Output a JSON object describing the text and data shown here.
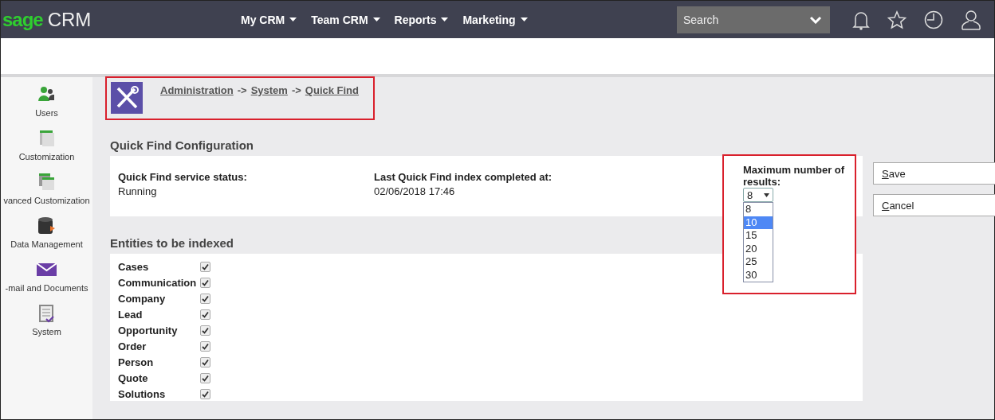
{
  "header": {
    "logo_brand": "sage",
    "logo_product": "CRM",
    "menus": [
      {
        "label": "My CRM"
      },
      {
        "label": "Team CRM"
      },
      {
        "label": "Reports"
      },
      {
        "label": "Marketing"
      }
    ],
    "search": {
      "placeholder": "Search"
    }
  },
  "sidebar": {
    "items": [
      {
        "label": "Users",
        "kind": "users"
      },
      {
        "label": "Customization",
        "kind": "custom"
      },
      {
        "label": "vanced Customization",
        "kind": "advanced"
      },
      {
        "label": "Data Management",
        "kind": "data"
      },
      {
        "label": "-mail and Documents",
        "kind": "mail"
      },
      {
        "label": "System",
        "kind": "system"
      }
    ]
  },
  "breadcrumb": {
    "highlighted": true,
    "links": [
      "Administration",
      "System",
      "Quick Find"
    ],
    "separator": "->"
  },
  "config": {
    "title": "Quick Find Configuration",
    "fields": [
      {
        "label": "Quick Find service status:",
        "value": "Running"
      },
      {
        "label": "Last Quick Find index completed at:",
        "value": "02/06/2018 17:46"
      }
    ],
    "max_results": {
      "highlighted": true,
      "label": "Maximum number of results:",
      "value": "8",
      "expanded": true,
      "options": [
        {
          "label": "8",
          "highlighted": false
        },
        {
          "label": "10",
          "highlighted": true
        },
        {
          "label": "15",
          "highlighted": false
        },
        {
          "label": "20",
          "highlighted": false
        },
        {
          "label": "25",
          "highlighted": false
        },
        {
          "label": "30",
          "highlighted": false
        }
      ]
    }
  },
  "entities": {
    "title": "Entities to be indexed",
    "items": [
      {
        "label": "Cases",
        "checked": true
      },
      {
        "label": "Communication",
        "checked": true
      },
      {
        "label": "Company",
        "checked": true
      },
      {
        "label": "Lead",
        "checked": true
      },
      {
        "label": "Opportunity",
        "checked": true
      },
      {
        "label": "Order",
        "checked": true
      },
      {
        "label": "Person",
        "checked": true
      },
      {
        "label": "Quote",
        "checked": true
      },
      {
        "label": "Solutions",
        "checked": true
      }
    ]
  },
  "buttons": [
    {
      "access_key": "S",
      "rest": "ave"
    },
    {
      "access_key": "C",
      "rest": "ancel"
    }
  ]
}
